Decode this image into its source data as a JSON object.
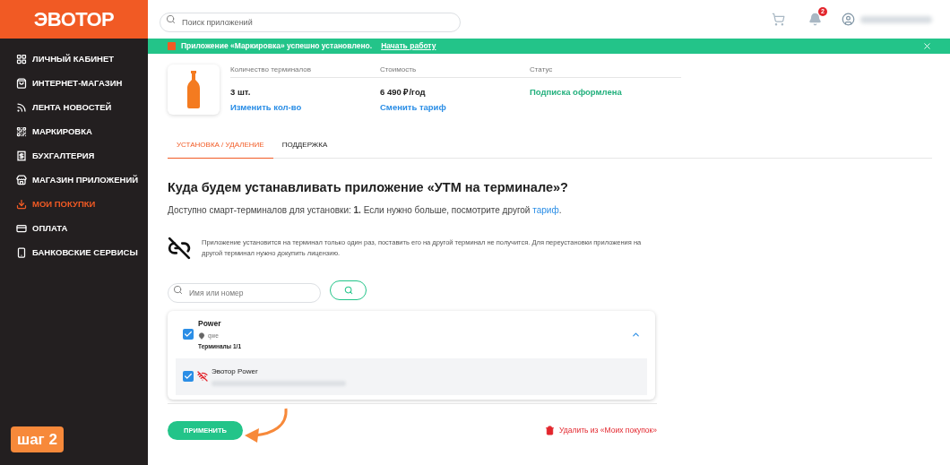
{
  "logo": "ЭВОТОР",
  "search": {
    "placeholder": "Поиск приложений"
  },
  "notifications": {
    "count": "2"
  },
  "sidebar": {
    "items": [
      {
        "label": "ЛИЧНЫЙ КАБИНЕТ",
        "selected": false
      },
      {
        "label": "ИНТЕРНЕТ-МАГАЗИН",
        "selected": false
      },
      {
        "label": "ЛЕНТА НОВОСТЕЙ",
        "selected": false
      },
      {
        "label": "МАРКИРОВКА",
        "selected": false
      },
      {
        "label": "БУХГАЛТЕРИЯ",
        "selected": false
      },
      {
        "label": "МАГАЗИН ПРИЛОЖЕНИЙ",
        "selected": false
      },
      {
        "label": "МОИ ПОКУПКИ",
        "selected": true
      },
      {
        "label": "ОПЛАТА",
        "selected": false
      },
      {
        "label": "БАНКОВСКИЕ СЕРВИСЫ",
        "selected": false
      }
    ]
  },
  "step_badge": "шаг 2",
  "banner": {
    "message": "Приложение «Маркировка» успешно установлено.",
    "link": "Начать работу"
  },
  "product": {
    "columns": [
      {
        "header": "Количество терминалов",
        "value": "3 шт.",
        "link": "Изменить кол-во"
      },
      {
        "header": "Стоимость",
        "value": "6 490 ₽/год",
        "link": "Сменить тариф"
      },
      {
        "header": "Статус",
        "value": "Подписка оформлена"
      }
    ]
  },
  "tabs": [
    {
      "label": "УСТАНОВКА / УДАЛЕНИЕ",
      "selected": true
    },
    {
      "label": "ПОДДЕРЖКА",
      "selected": false
    }
  ],
  "heading": "Куда будем устанавливать приложение «УТМ на терминале»?",
  "subtitle": {
    "text": "Доступно смарт-терминалов для установки: **1.** Если нужно больше, посмотрите другой ",
    "link": "тариф",
    "end": "."
  },
  "notice": "Приложение установится на терминал только один раз, поставить его на другой терминал не получится. Для переустановки приложения на другой терминал нужно докупить лицензию.",
  "terminal_search": {
    "placeholder": "Имя или номер"
  },
  "groups": [
    {
      "name": "Power",
      "location": "qwe",
      "count": "Терминалы 1/1",
      "checked": true,
      "expanded": true,
      "terminals": [
        {
          "name": "Эвотор Power",
          "checked": true
        }
      ]
    }
  ],
  "apply_button": "ПРИМЕНИТЬ",
  "delete_link": "Удалить из «Моих покупок»"
}
